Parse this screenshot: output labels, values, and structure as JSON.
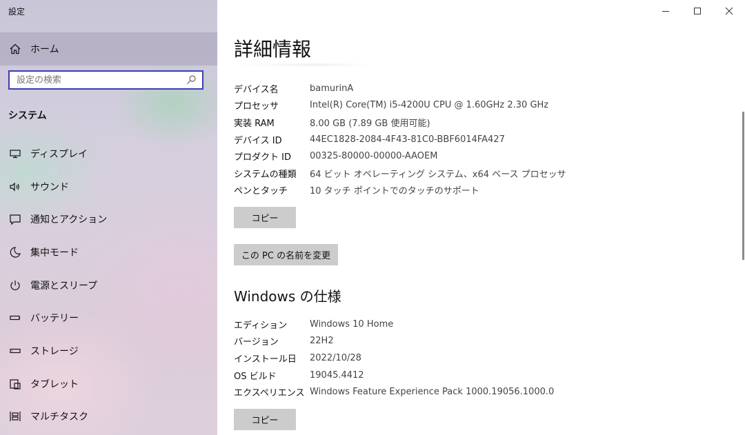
{
  "window": {
    "title": "設定"
  },
  "sidebar": {
    "home_label": "ホーム",
    "search_placeholder": "設定の検索",
    "section_title": "システム",
    "items": [
      {
        "label": "ディスプレイ",
        "icon": "display-icon"
      },
      {
        "label": "サウンド",
        "icon": "speaker-icon"
      },
      {
        "label": "通知とアクション",
        "icon": "notification-icon"
      },
      {
        "label": "集中モード",
        "icon": "moon-icon"
      },
      {
        "label": "電源とスリープ",
        "icon": "power-icon"
      },
      {
        "label": "バッテリー",
        "icon": "battery-icon"
      },
      {
        "label": "ストレージ",
        "icon": "storage-icon"
      },
      {
        "label": "タブレット",
        "icon": "tablet-icon"
      },
      {
        "label": "マルチタスク",
        "icon": "multitasking-icon"
      }
    ]
  },
  "main": {
    "title": "詳細情報",
    "device_specs": [
      {
        "key": "デバイス名",
        "value": "bamurinA"
      },
      {
        "key": "プロセッサ",
        "value": "Intel(R) Core(TM) i5-4200U CPU @ 1.60GHz   2.30 GHz"
      },
      {
        "key": "実装 RAM",
        "value": "8.00 GB (7.89 GB 使用可能)"
      },
      {
        "key": "デバイス ID",
        "value": "44EC1828-2084-4F43-81C0-BBF6014FA427"
      },
      {
        "key": "プロダクト ID",
        "value": "00325-80000-00000-AAOEM"
      },
      {
        "key": "システムの種類",
        "value": "64 ビット オペレーティング システム、x64 ベース プロセッサ"
      },
      {
        "key": "ペンとタッチ",
        "value": "10 タッチ ポイントでのタッチのサポート"
      }
    ],
    "copy_button": "コピー",
    "rename_button": "この PC の名前を変更",
    "windows_section_title": "Windows の仕様",
    "windows_specs": [
      {
        "key": "エディション",
        "value": "Windows 10 Home"
      },
      {
        "key": "バージョン",
        "value": "22H2"
      },
      {
        "key": "インストール日",
        "value": "2022/10/28"
      },
      {
        "key": "OS ビルド",
        "value": "19045.4412"
      },
      {
        "key": "エクスペリエンス",
        "value": "Windows Feature Experience Pack 1000.19056.1000.0"
      }
    ],
    "copy_button_2": "コピー"
  }
}
